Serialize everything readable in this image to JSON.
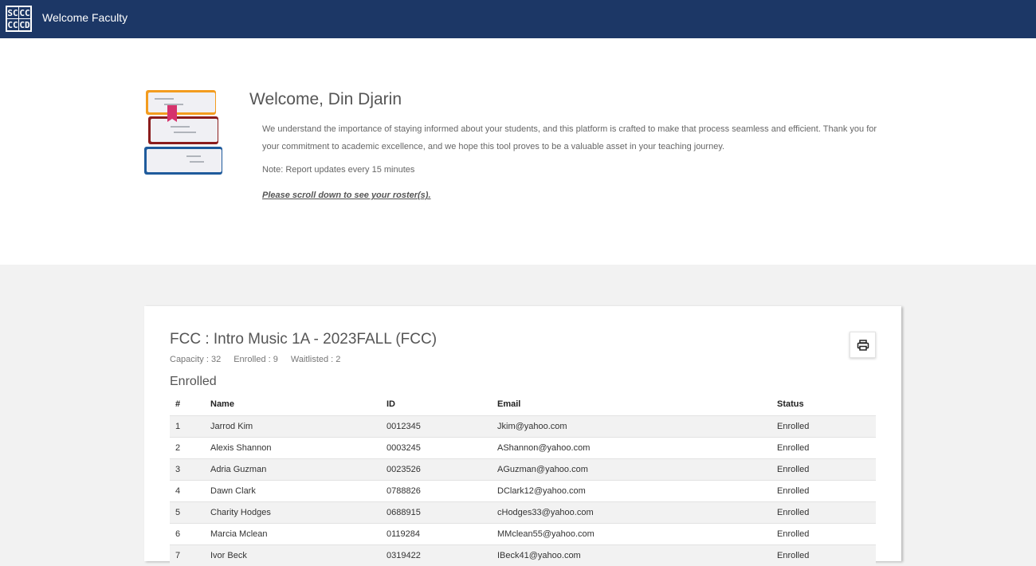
{
  "header": {
    "logo_letters": [
      "SC",
      "CC",
      "CC",
      "CD"
    ],
    "title": "Welcome Faculty"
  },
  "welcome": {
    "title": "Welcome, Din Djarin",
    "text": "We understand the importance of staying informed about your students, and this platform is crafted to make that process seamless and efficient. Thank you for your commitment to academic excellence, and we hope this tool proves to be a valuable asset in your teaching journey.",
    "note": "Note: Report updates every 15 minutes",
    "scroll_note": "Please scroll down to see your roster(s)."
  },
  "course": {
    "title": "FCC : Intro Music 1A - 2023FALL (FCC)",
    "capacity": "Capacity : 32",
    "enrolled": "Enrolled : 9",
    "waitlisted": "Waitlisted : 2",
    "print_icon": "printer-icon",
    "section_title": "Enrolled",
    "columns": [
      "#",
      "Name",
      "ID",
      "Email",
      "Status"
    ],
    "rows": [
      [
        "1",
        "Jarrod Kim",
        "0012345",
        "Jkim@yahoo.com",
        "Enrolled"
      ],
      [
        "2",
        "Alexis Shannon",
        "0003245",
        "AShannon@yahoo.com",
        "Enrolled"
      ],
      [
        "3",
        "Adria Guzman",
        "0023526",
        "AGuzman@yahoo.com",
        "Enrolled"
      ],
      [
        "4",
        "Dawn Clark",
        "0788826",
        "DClark12@yahoo.com",
        "Enrolled"
      ],
      [
        "5",
        "Charity Hodges",
        "0688915",
        "cHodges33@yahoo.com",
        "Enrolled"
      ],
      [
        "6",
        "Marcia Mclean",
        "0119284",
        "MMclean55@yahoo.com",
        "Enrolled"
      ],
      [
        "7",
        "Ivor Beck",
        "0319422",
        "IBeck41@yahoo.com",
        "Enrolled"
      ]
    ]
  },
  "colors": {
    "header_bg": "#1c3766",
    "book_orange": "#f39c1f",
    "book_red": "#8b1c1c",
    "book_blue": "#1f5b9c",
    "bookmark": "#d6336c"
  }
}
